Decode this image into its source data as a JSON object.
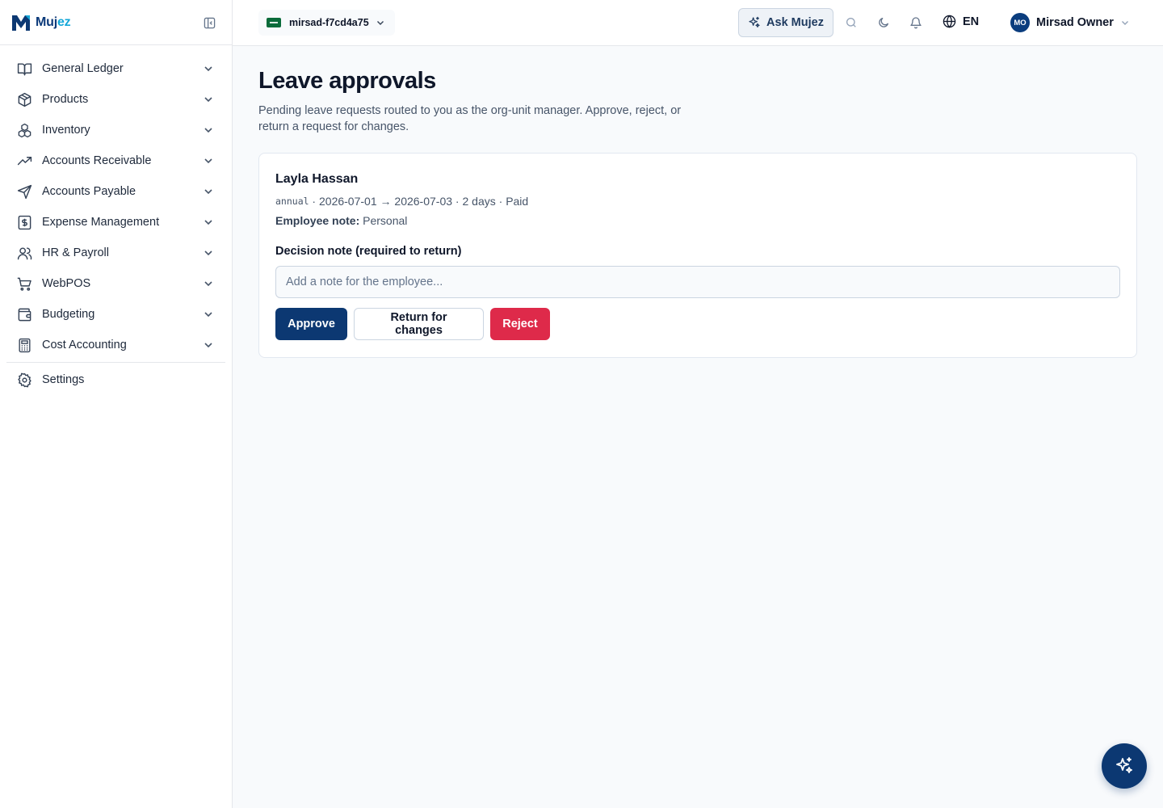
{
  "brand": {
    "name_part1": "Muj",
    "name_part2": "ez",
    "accent": "#0c3872",
    "accent_light": "#14a7d8"
  },
  "sidebar": {
    "items": [
      {
        "label": "General Ledger",
        "icon": "book-open-icon"
      },
      {
        "label": "Products",
        "icon": "package-icon"
      },
      {
        "label": "Inventory",
        "icon": "boxes-icon"
      },
      {
        "label": "Accounts Receivable",
        "icon": "trending-up-icon"
      },
      {
        "label": "Accounts Payable",
        "icon": "send-icon"
      },
      {
        "label": "Expense Management",
        "icon": "receipt-dollar-icon"
      },
      {
        "label": "HR & Payroll",
        "icon": "users-icon"
      },
      {
        "label": "WebPOS",
        "icon": "shopping-cart-icon"
      },
      {
        "label": "Budgeting",
        "icon": "wallet-icon"
      },
      {
        "label": "Cost Accounting",
        "icon": "calculator-icon"
      }
    ],
    "settings_label": "Settings"
  },
  "topbar": {
    "tenant": "mirsad-f7cd4a75",
    "ask_label": "Ask Mujez",
    "language": "EN",
    "user_initials": "MO",
    "user_name": "Mirsad Owner"
  },
  "main": {
    "title": "Leave approvals",
    "description": "Pending leave requests routed to you as the org-unit manager. Approve, reject, or return a request for changes.",
    "request": {
      "employee": "Layla Hassan",
      "leave_type": "annual",
      "sep1": " · ",
      "start": "2026-07-01",
      "arrow": " → ",
      "end": "2026-07-03",
      "sep2": " · ",
      "days": "2 days",
      "sep3": " · ",
      "pay": "Paid",
      "note_key": "Employee note:",
      "note_value": " Personal"
    },
    "decision_label": "Decision note (required to return)",
    "decision_placeholder": "Add a note for the employee...",
    "approve_label": "Approve",
    "return_label": "Return for changes",
    "reject_label": "Reject"
  }
}
